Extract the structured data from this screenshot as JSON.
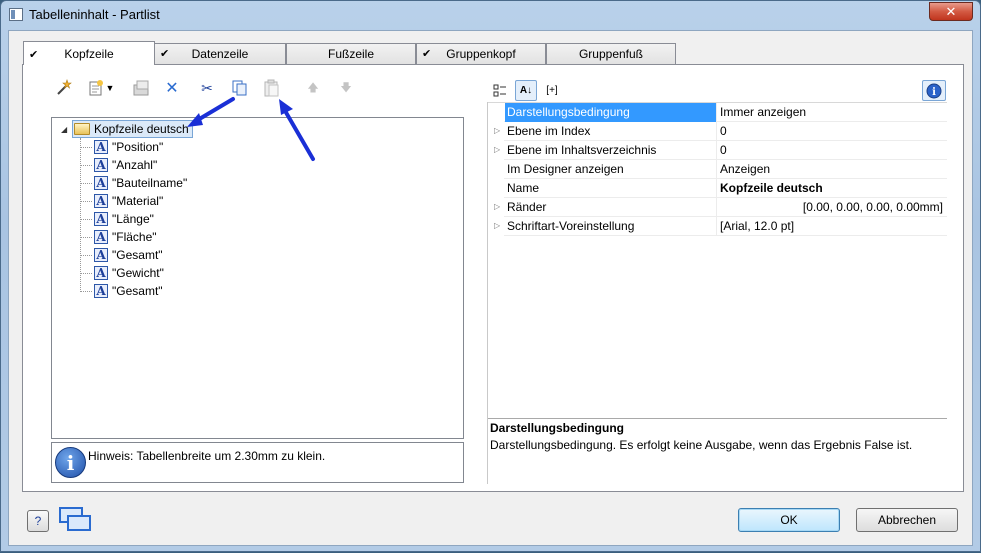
{
  "window": {
    "title": "Tabelleninhalt - Partlist",
    "close_glyph": "✕"
  },
  "tabs": [
    {
      "label": "Kopfzeile",
      "checked": true,
      "active": true
    },
    {
      "label": "Datenzeile",
      "checked": true,
      "active": false
    },
    {
      "label": "Fußzeile",
      "checked": false,
      "active": false
    },
    {
      "label": "Gruppenkopf",
      "checked": true,
      "active": false
    },
    {
      "label": "Gruppenfuß",
      "checked": false,
      "active": false
    }
  ],
  "toolbar": {
    "icons": [
      "wizard-icon",
      "new-item-icon",
      "dropdown-arrow-icon",
      "properties-icon",
      "delete-icon",
      "cut-icon",
      "copy-icon",
      "paste-icon",
      "move-up-icon",
      "move-down-icon"
    ]
  },
  "tree": {
    "root_label": "Kopfzeile deutsch",
    "items": [
      "\"Position\"",
      "\"Anzahl\"",
      "\"Bauteilname\"",
      "\"Material\"",
      "\"Länge\"",
      "\"Fläche\"",
      "\"Gesamt\"",
      "\"Gewicht\"",
      "\"Gesamt\""
    ]
  },
  "hint": {
    "text": "Hinweis: Tabellenbreite um 2.30mm zu klein."
  },
  "property_toolbar": {
    "expand_label": "[+]"
  },
  "properties": [
    {
      "name": "Darstellungsbedingung",
      "value": "Immer anzeigen",
      "expandable": false,
      "selected": true,
      "bold": false,
      "align": "left"
    },
    {
      "name": "Ebene im Index",
      "value": "0",
      "expandable": true,
      "selected": false,
      "bold": false,
      "align": "left"
    },
    {
      "name": "Ebene im Inhaltsverzeichnis",
      "value": "0",
      "expandable": true,
      "selected": false,
      "bold": false,
      "align": "left"
    },
    {
      "name": "Im Designer anzeigen",
      "value": "Anzeigen",
      "expandable": false,
      "selected": false,
      "bold": false,
      "align": "left"
    },
    {
      "name": "Name",
      "value": "Kopfzeile deutsch",
      "expandable": false,
      "selected": false,
      "bold": true,
      "align": "left"
    },
    {
      "name": "Ränder",
      "value": "[0.00, 0.00, 0.00, 0.00mm]",
      "expandable": true,
      "selected": false,
      "bold": false,
      "align": "right"
    },
    {
      "name": "Schriftart-Voreinstellung",
      "value": "[Arial, 12.0 pt]",
      "expandable": true,
      "selected": false,
      "bold": false,
      "align": "left"
    }
  ],
  "description": {
    "title": "Darstellungsbedingung",
    "text": "Darstellungsbedingung. Es erfolgt keine Ausgabe, wenn das Ergebnis False ist."
  },
  "buttons": {
    "ok": "OK",
    "cancel": "Abbrechen"
  },
  "colors": {
    "selection": "#3399ff",
    "annotation_arrow": "#1a2fd6",
    "accent": "#2a6bd0"
  }
}
